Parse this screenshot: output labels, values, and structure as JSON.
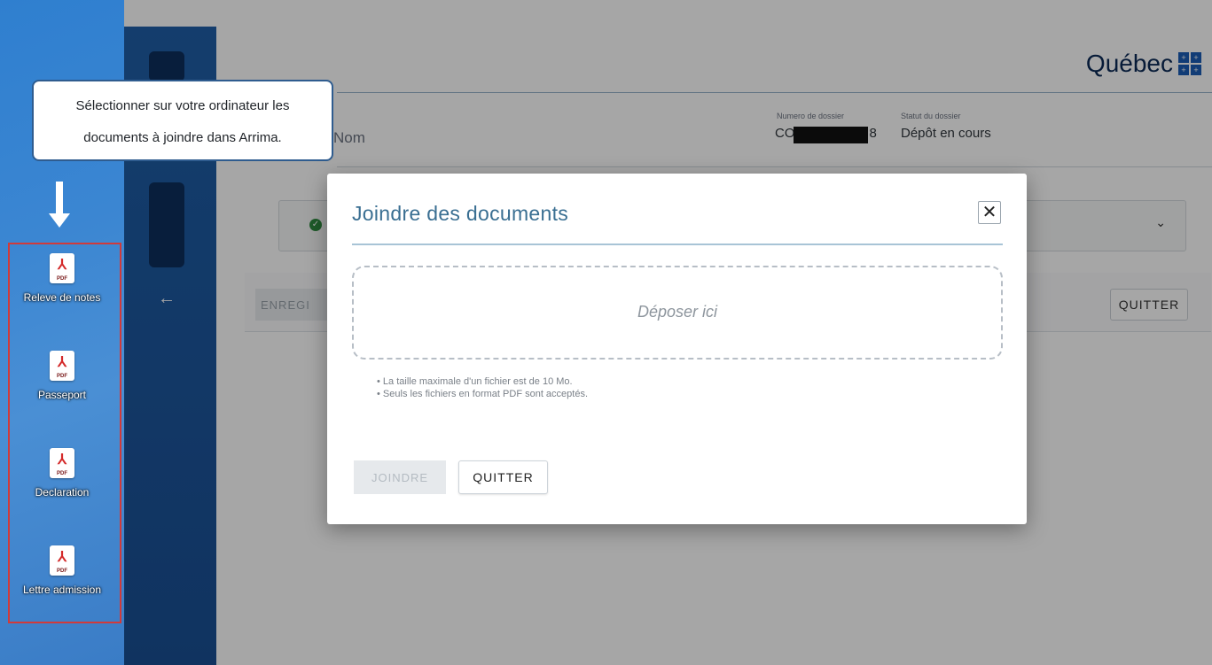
{
  "app": {
    "brand": "Québec",
    "field_name_label": "Nom",
    "dossier_label": "Numero de dossier",
    "dossier_value_prefix": "CO",
    "dossier_value_suffix": "8",
    "statut_label": "Statut du dossier",
    "statut_value": "Dépôt en cours",
    "save_button": "ENREGI",
    "quit_button": "QUITTER"
  },
  "callout": {
    "line1": "Sélectionner sur votre ordinateur les",
    "line2": "documents à joindre dans Arrima."
  },
  "desktop_files": [
    {
      "label": "Releve de notes"
    },
    {
      "label": "Passeport"
    },
    {
      "label": "Declaration"
    },
    {
      "label": "Lettre admission"
    }
  ],
  "pdf_tag": "PDF",
  "modal": {
    "title": "Joindre des documents",
    "close_symbol": "✕",
    "dropzone_text": "Déposer ici",
    "rules": [
      "La taille maximale d'un fichier est de 10 Mo.",
      "Seuls les fichiers en format PDF sont acceptés."
    ],
    "join_button": "JOINDRE",
    "quit_button": "QUITTER"
  }
}
